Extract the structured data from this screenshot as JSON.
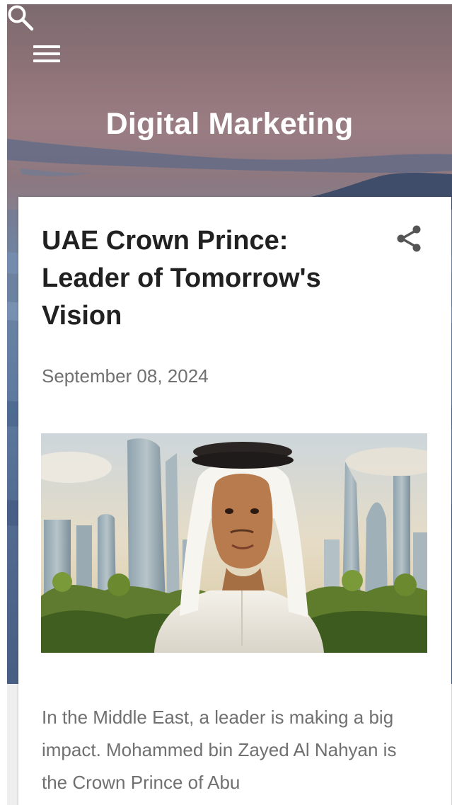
{
  "header": {
    "blog_title": "Digital Marketing",
    "menu_icon": "menu-icon",
    "search_icon": "search-icon"
  },
  "post": {
    "title": "UAE Crown Prince: Leader of Tomorrow's Vision",
    "date": "September 08, 2024",
    "share_icon": "share-icon",
    "snippet": "In the Middle East, a leader is making a big impact. Mohammed bin Zayed Al Nahyan is the Crown Prince of Abu"
  },
  "colors": {
    "header_text": "#ffffff",
    "title_text": "#212121",
    "meta_text": "#707070",
    "card_background": "#ffffff",
    "page_background": "#efefef"
  }
}
